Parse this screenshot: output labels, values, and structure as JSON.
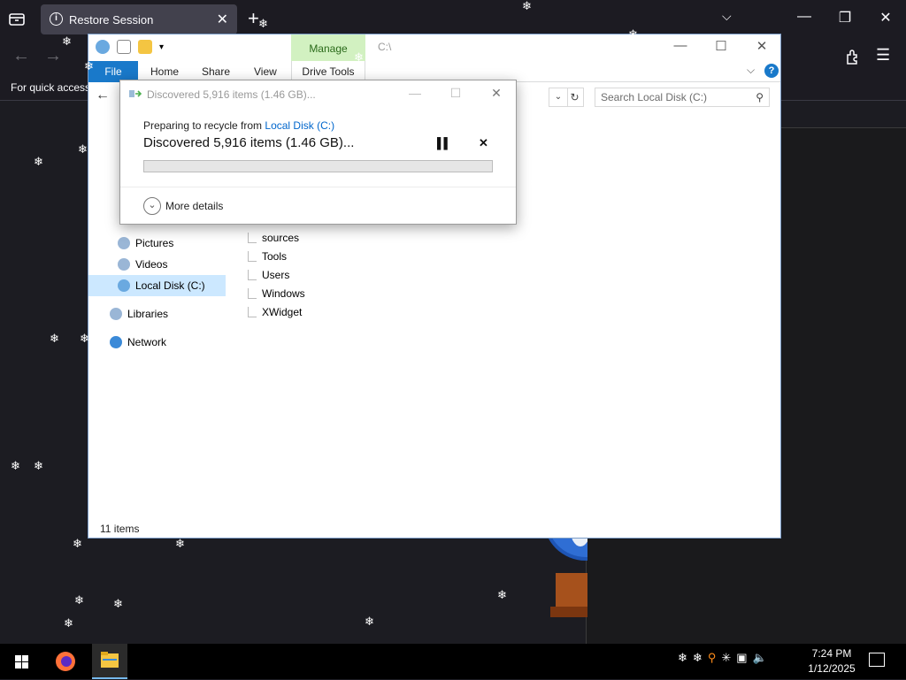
{
  "browser": {
    "tab_title": "Restore Session",
    "bookmark_hint": "For quick access"
  },
  "explorer": {
    "title_path": "C:\\",
    "manage_label": "Manage",
    "ribbon_tabs": [
      "File",
      "Home",
      "Share",
      "View",
      "Drive Tools"
    ],
    "search_placeholder": "Search Local Disk (C:)",
    "nav_items": [
      {
        "label": "Pictures",
        "icon": "pictures-icon",
        "selected": false
      },
      {
        "label": "Videos",
        "icon": "videos-icon",
        "selected": false
      },
      {
        "label": "Local Disk (C:)",
        "icon": "drive-icon",
        "selected": true
      },
      {
        "label": "Libraries",
        "icon": "libraries-icon",
        "selected": false
      },
      {
        "label": "Network",
        "icon": "network-icon",
        "selected": false
      }
    ],
    "files": [
      "sources",
      "Tools",
      "Users",
      "Windows",
      "XWidget"
    ],
    "status": "11 items"
  },
  "dialog": {
    "title": "Discovered 5,916 items (1.46 GB)...",
    "line1_prefix": "Preparing to recycle from ",
    "source": "Local Disk (C:)",
    "main_text": "Discovered 5,916 items (1.46 GB)...",
    "progress": 0,
    "more_details": "More details"
  },
  "taskbar": {
    "time": "7:24 PM",
    "date": "1/12/2025"
  },
  "colors": {
    "accent": "#1979ca",
    "manage_bg": "#d2f1c1",
    "selected_bg": "#cce8ff",
    "link": "#0066cc"
  }
}
